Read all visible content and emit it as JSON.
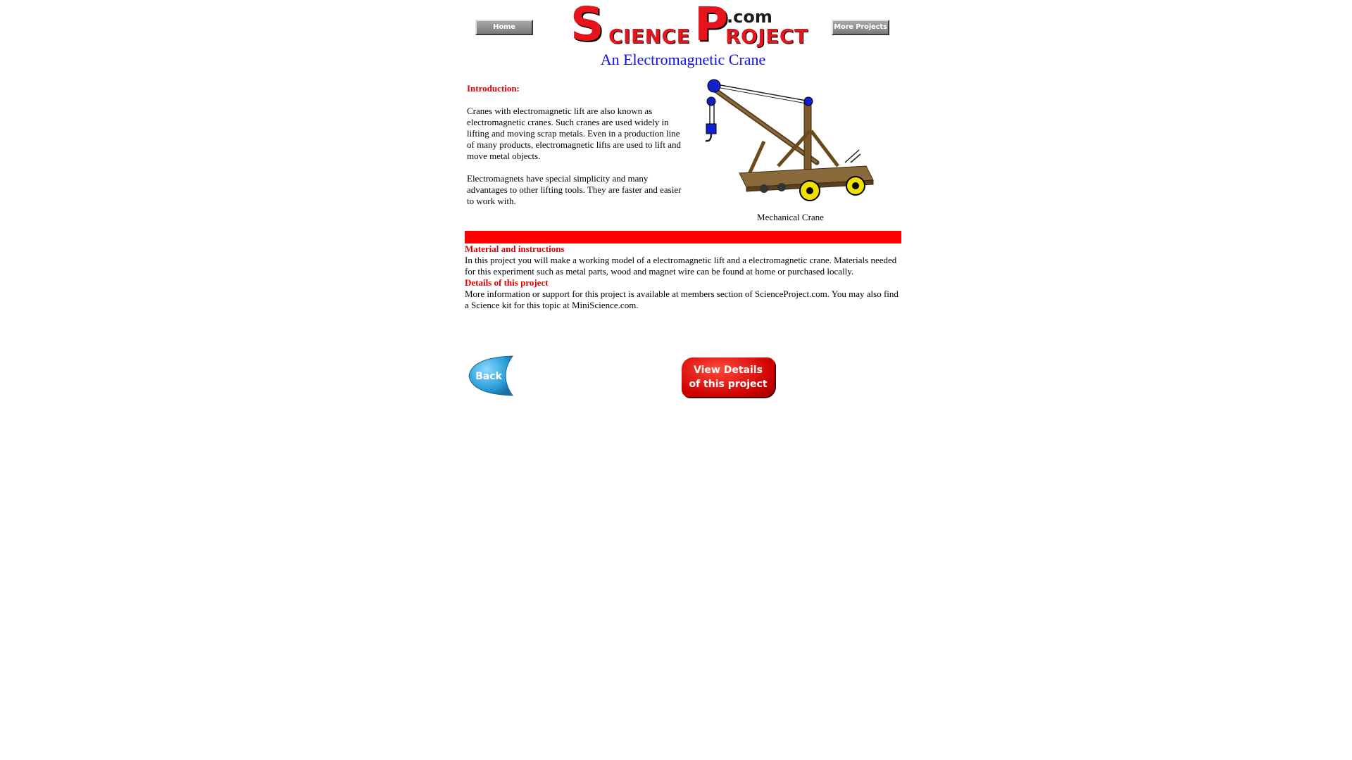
{
  "nav": {
    "home_label": "Home",
    "more_label": "More Projects"
  },
  "logo": {
    "s": "S",
    "cience": "CIENCE",
    "p": "P",
    "roject": "ROJECT",
    "dotcom": ".com"
  },
  "page_title": "An Electromagnetic Crane",
  "intro": {
    "heading": "Introduction:",
    "paragraph1": "Cranes with electromagnetic lift are also known as electromagnetic cranes. Such cranes are used widely in lifting and moving scrap metals. Even in a production line of many products, electromagnetic lifts are used to lift and move metal objects.",
    "paragraph2": "Electromagnets have special simplicity and many advantages to other lifting tools. They are faster and easier to work with.",
    "image_caption": "Mechanical Crane"
  },
  "materials": {
    "heading": "Material and instructions",
    "text": "In this project you will make a working model of a electromagnetic lift and a electromagnetic crane. Materials needed for this experiment such as metal parts, wood and magnet wire can be found at home or purchased locally."
  },
  "details": {
    "heading": "Details of this project",
    "text": "More information or support for this project is available at members section of ScienceProject.com. You may also find a Science kit for this topic at MiniScience.com."
  },
  "buttons": {
    "back_label": "Back",
    "view_line1": "View Details",
    "view_line2": "of this project"
  },
  "colors": {
    "accent_red": "#ff0000",
    "title_blue": "#1010e0"
  }
}
